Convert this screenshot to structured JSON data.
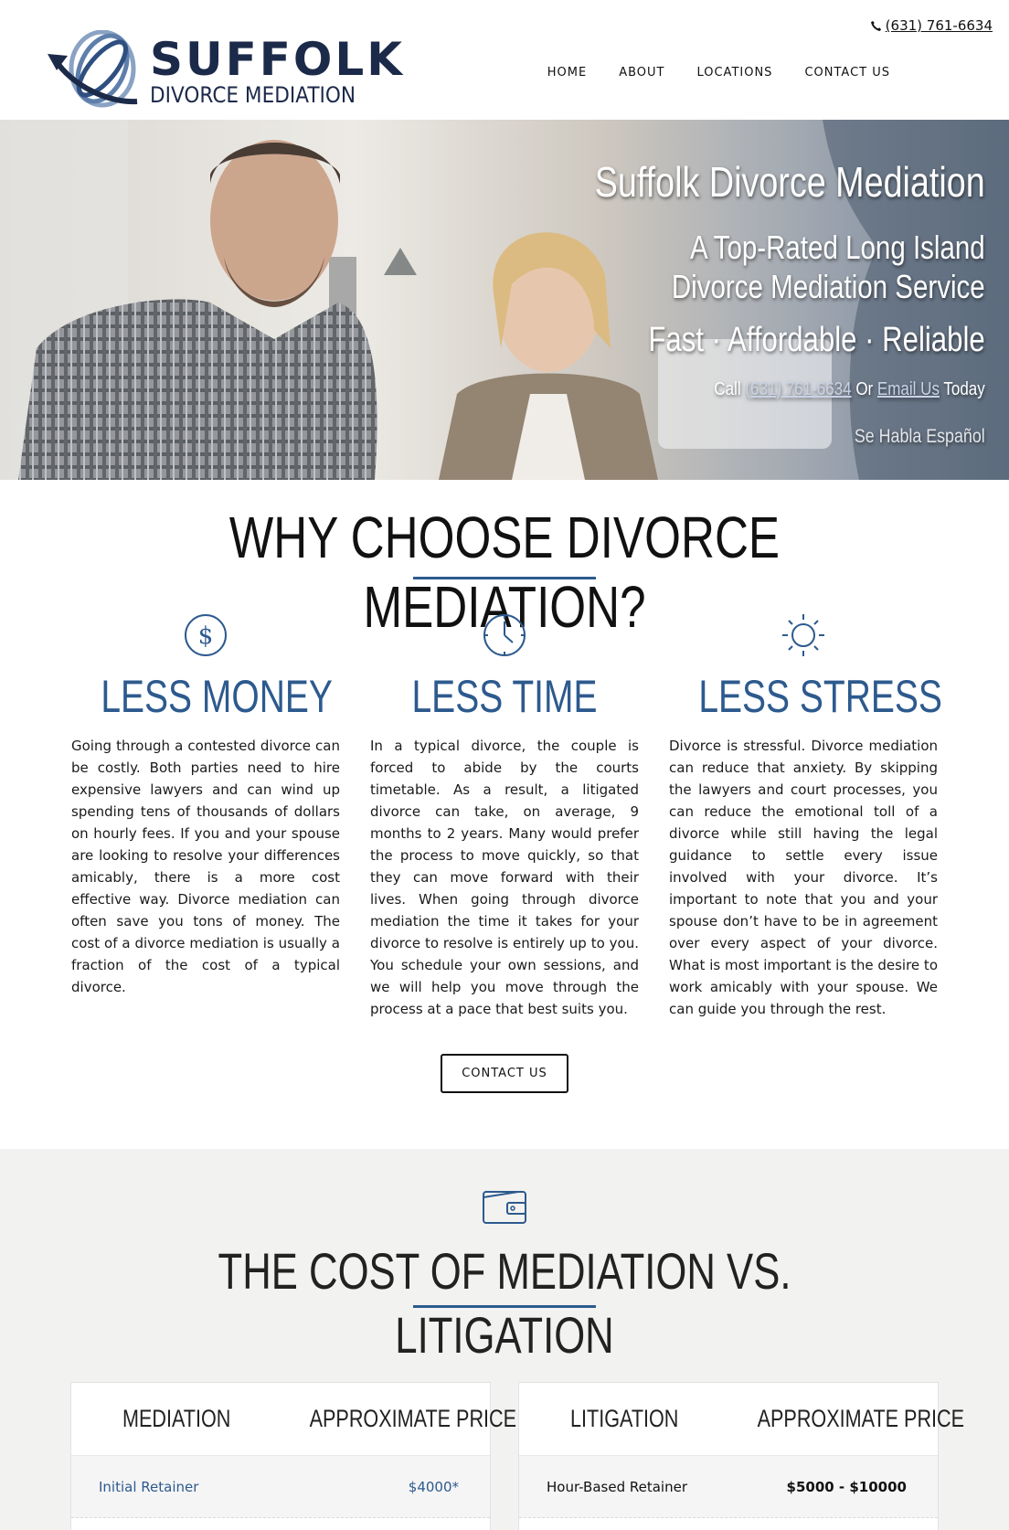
{
  "header": {
    "phone": "(631) 761-6634",
    "logo": {
      "line1": "SUFFOLK",
      "line2": "DIVORCE MEDIATION"
    },
    "nav": [
      "HOME",
      "ABOUT",
      "LOCATIONS",
      "CONTACT US"
    ]
  },
  "hero": {
    "title": "Suffolk Divorce Mediation",
    "subtitle_line1": "A Top-Rated Long Island",
    "subtitle_line2": "Divorce Mediation Service",
    "tagline": "Fast · Affordable · Reliable",
    "call_prefix": "Call",
    "call_phone": "(631) 761-6634",
    "call_or": "Or",
    "call_email": "Email Us",
    "call_suffix": "Today",
    "spanish": "Se Habla Español"
  },
  "why": {
    "title": "WHY CHOOSE DIVORCE MEDIATION?",
    "columns": [
      {
        "icon": "dollar-icon",
        "heading": "LESS MONEY",
        "text": "Going through a contested divorce can be costly. Both parties need to hire expensive lawyers and can wind up spending tens of thousands of dollars on hourly fees. If you and your spouse are looking to resolve your differences amicably, there is a more cost effective way. Divorce mediation can often save you tons of money. The cost of a divorce mediation is usually a fraction of the cost of a typical divorce."
      },
      {
        "icon": "clock-icon",
        "heading": "LESS TIME",
        "text": "In a typical divorce, the couple is forced to abide by the courts timetable. As a result, a litigated divorce can take, on average, 9 months to 2 years. Many would prefer the process to move quickly, so that they can move forward with their lives. When going through divorce mediation the time it takes for your divorce to resolve is entirely up to you. You schedule your own sessions, and we will help you move through the process at a pace that best suits you."
      },
      {
        "icon": "sun-icon",
        "heading": "LESS STRESS",
        "text": "Divorce is stressful. Divorce mediation can reduce that anxiety. By skipping the lawyers and court processes, you can reduce the emotional toll of a divorce while still having the legal guidance to settle every issue involved with your divorce. It’s important to note that you and your spouse don’t have to be in agreement over every aspect of your divorce. What is most important is the desire to work amicably with your spouse. We can guide you through the rest."
      }
    ],
    "button": "CONTACT US"
  },
  "cost": {
    "title": "THE COST OF MEDIATION VS. LITIGATION",
    "mediation": {
      "col1": "MEDIATION",
      "col2": "APPROXIMATE PRICE",
      "rows": [
        {
          "item": "Initial Retainer",
          "price": "$4000*"
        }
      ]
    },
    "litigation": {
      "col1": "LITIGATION",
      "col2": "APPROXIMATE PRICE",
      "rows": [
        {
          "item": "Hour-Based Retainer",
          "price": "$5000 - $10000"
        }
      ]
    }
  },
  "colors": {
    "accent": "#2d5a8e",
    "navy": "#1c2a4a",
    "section_bg": "#f2f2f1"
  }
}
